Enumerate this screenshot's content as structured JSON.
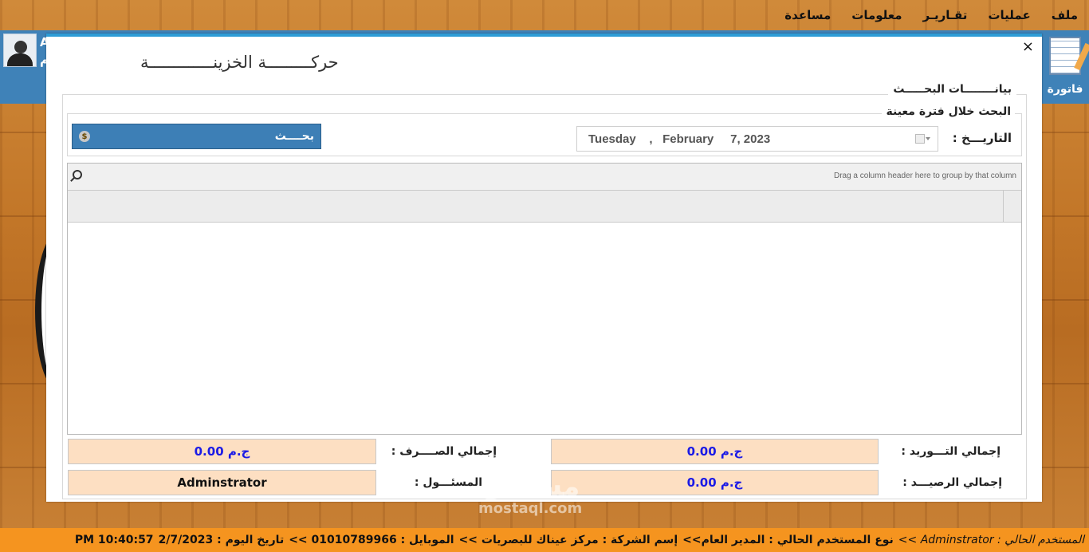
{
  "menu": [
    "ملف",
    "عمليات",
    "تقـاريـر",
    "معلومات",
    "مساعدة"
  ],
  "side_letters": [
    "A",
    "م"
  ],
  "invoice_tile": {
    "label": "فاتورة"
  },
  "dialog": {
    "title": "حركـــــــــة الخزينـــــــــــــة",
    "close": "×",
    "group_title": "بيانــــــــات البحـــــث",
    "period_title": "البحث خلال فترة معينة",
    "date_label": "التاريـــخ :",
    "date_value": "Tuesday    ,   February     7, 2023",
    "search_button": "بحــــث",
    "grid": {
      "group_hint": "Drag a column header here to group by that column"
    },
    "totals": {
      "incoming_label": "إجمالي التـــوريد :",
      "incoming_value": "0.00 ج.م",
      "spend_label": "إجمالي الصــــرف :",
      "spend_value": "0.00 ج.م",
      "balance_label": "إجمالي الرصيـــد :",
      "balance_value": "0.00 ج.م",
      "responsible_label": "المسئـــول :",
      "responsible_value": "Adminstrator"
    }
  },
  "status": {
    "current_user": "المستخدم الحالي : Adminstrator >>",
    "user_type": "نوع المستخدم الحالي : المدير العام>>",
    "company": "إسم الشركة : مركز عيناك للبصريات >>",
    "mobile": "الموبايل : 01010789966 >>",
    "today": "تاريخ اليوم : 2/7/2023",
    "time": "10:40:57 PM"
  },
  "watermark": {
    "main": "مستقل",
    "sub": "mostaql.com"
  },
  "colors": {
    "accent": "#2d9cd6",
    "button": "#3d7fb6",
    "total_box": "#fddfc2",
    "status_bar": "#f5941f",
    "money_text": "#1a1ae6"
  }
}
